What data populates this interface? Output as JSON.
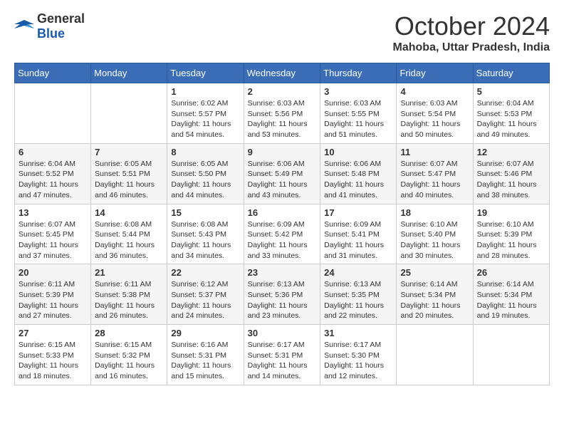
{
  "logo": {
    "general": "General",
    "blue": "Blue"
  },
  "title": "October 2024",
  "location": "Mahoba, Uttar Pradesh, India",
  "weekdays": [
    "Sunday",
    "Monday",
    "Tuesday",
    "Wednesday",
    "Thursday",
    "Friday",
    "Saturday"
  ],
  "weeks": [
    [
      {
        "day": "",
        "info": ""
      },
      {
        "day": "",
        "info": ""
      },
      {
        "day": "1",
        "info": "Sunrise: 6:02 AM\nSunset: 5:57 PM\nDaylight: 11 hours and 54 minutes."
      },
      {
        "day": "2",
        "info": "Sunrise: 6:03 AM\nSunset: 5:56 PM\nDaylight: 11 hours and 53 minutes."
      },
      {
        "day": "3",
        "info": "Sunrise: 6:03 AM\nSunset: 5:55 PM\nDaylight: 11 hours and 51 minutes."
      },
      {
        "day": "4",
        "info": "Sunrise: 6:03 AM\nSunset: 5:54 PM\nDaylight: 11 hours and 50 minutes."
      },
      {
        "day": "5",
        "info": "Sunrise: 6:04 AM\nSunset: 5:53 PM\nDaylight: 11 hours and 49 minutes."
      }
    ],
    [
      {
        "day": "6",
        "info": "Sunrise: 6:04 AM\nSunset: 5:52 PM\nDaylight: 11 hours and 47 minutes."
      },
      {
        "day": "7",
        "info": "Sunrise: 6:05 AM\nSunset: 5:51 PM\nDaylight: 11 hours and 46 minutes."
      },
      {
        "day": "8",
        "info": "Sunrise: 6:05 AM\nSunset: 5:50 PM\nDaylight: 11 hours and 44 minutes."
      },
      {
        "day": "9",
        "info": "Sunrise: 6:06 AM\nSunset: 5:49 PM\nDaylight: 11 hours and 43 minutes."
      },
      {
        "day": "10",
        "info": "Sunrise: 6:06 AM\nSunset: 5:48 PM\nDaylight: 11 hours and 41 minutes."
      },
      {
        "day": "11",
        "info": "Sunrise: 6:07 AM\nSunset: 5:47 PM\nDaylight: 11 hours and 40 minutes."
      },
      {
        "day": "12",
        "info": "Sunrise: 6:07 AM\nSunset: 5:46 PM\nDaylight: 11 hours and 38 minutes."
      }
    ],
    [
      {
        "day": "13",
        "info": "Sunrise: 6:07 AM\nSunset: 5:45 PM\nDaylight: 11 hours and 37 minutes."
      },
      {
        "day": "14",
        "info": "Sunrise: 6:08 AM\nSunset: 5:44 PM\nDaylight: 11 hours and 36 minutes."
      },
      {
        "day": "15",
        "info": "Sunrise: 6:08 AM\nSunset: 5:43 PM\nDaylight: 11 hours and 34 minutes."
      },
      {
        "day": "16",
        "info": "Sunrise: 6:09 AM\nSunset: 5:42 PM\nDaylight: 11 hours and 33 minutes."
      },
      {
        "day": "17",
        "info": "Sunrise: 6:09 AM\nSunset: 5:41 PM\nDaylight: 11 hours and 31 minutes."
      },
      {
        "day": "18",
        "info": "Sunrise: 6:10 AM\nSunset: 5:40 PM\nDaylight: 11 hours and 30 minutes."
      },
      {
        "day": "19",
        "info": "Sunrise: 6:10 AM\nSunset: 5:39 PM\nDaylight: 11 hours and 28 minutes."
      }
    ],
    [
      {
        "day": "20",
        "info": "Sunrise: 6:11 AM\nSunset: 5:39 PM\nDaylight: 11 hours and 27 minutes."
      },
      {
        "day": "21",
        "info": "Sunrise: 6:11 AM\nSunset: 5:38 PM\nDaylight: 11 hours and 26 minutes."
      },
      {
        "day": "22",
        "info": "Sunrise: 6:12 AM\nSunset: 5:37 PM\nDaylight: 11 hours and 24 minutes."
      },
      {
        "day": "23",
        "info": "Sunrise: 6:13 AM\nSunset: 5:36 PM\nDaylight: 11 hours and 23 minutes."
      },
      {
        "day": "24",
        "info": "Sunrise: 6:13 AM\nSunset: 5:35 PM\nDaylight: 11 hours and 22 minutes."
      },
      {
        "day": "25",
        "info": "Sunrise: 6:14 AM\nSunset: 5:34 PM\nDaylight: 11 hours and 20 minutes."
      },
      {
        "day": "26",
        "info": "Sunrise: 6:14 AM\nSunset: 5:34 PM\nDaylight: 11 hours and 19 minutes."
      }
    ],
    [
      {
        "day": "27",
        "info": "Sunrise: 6:15 AM\nSunset: 5:33 PM\nDaylight: 11 hours and 18 minutes."
      },
      {
        "day": "28",
        "info": "Sunrise: 6:15 AM\nSunset: 5:32 PM\nDaylight: 11 hours and 16 minutes."
      },
      {
        "day": "29",
        "info": "Sunrise: 6:16 AM\nSunset: 5:31 PM\nDaylight: 11 hours and 15 minutes."
      },
      {
        "day": "30",
        "info": "Sunrise: 6:17 AM\nSunset: 5:31 PM\nDaylight: 11 hours and 14 minutes."
      },
      {
        "day": "31",
        "info": "Sunrise: 6:17 AM\nSunset: 5:30 PM\nDaylight: 11 hours and 12 minutes."
      },
      {
        "day": "",
        "info": ""
      },
      {
        "day": "",
        "info": ""
      }
    ]
  ]
}
